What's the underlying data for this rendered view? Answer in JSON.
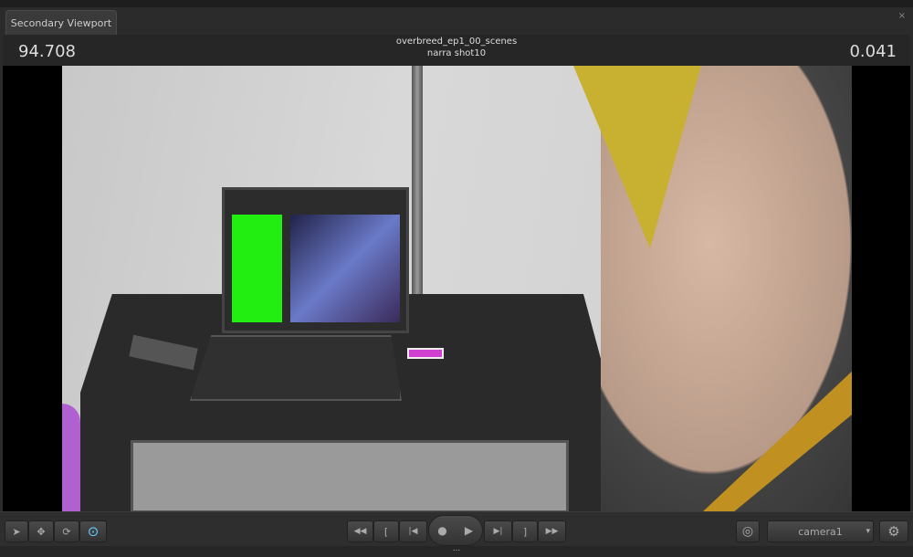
{
  "tab": {
    "label": "Secondary Viewport",
    "close": "×"
  },
  "header": {
    "left_value": "94.708",
    "right_value": "0.041",
    "session": "overbreed_ep1_00_scenes",
    "shot": "narra shot10"
  },
  "toolbar": {
    "tools": [
      {
        "icon": "select-arrow-icon",
        "glyph": "➤"
      },
      {
        "icon": "move-icon",
        "glyph": "✥"
      },
      {
        "icon": "rotate-icon",
        "glyph": "⟳"
      },
      {
        "icon": "orbit-icon",
        "glyph": "⊙"
      }
    ],
    "transport": {
      "rewind": "◀◀",
      "mark_in": "[",
      "prev": "|◀",
      "record": "●",
      "play": "▶",
      "next": "▶|",
      "mark_out": "]",
      "fast_forward": "▶▶"
    },
    "target_glyph": "◎",
    "camera": "camera1",
    "dropdown_glyph": "▾",
    "settings_glyph": "⚙"
  },
  "splitter": "..."
}
